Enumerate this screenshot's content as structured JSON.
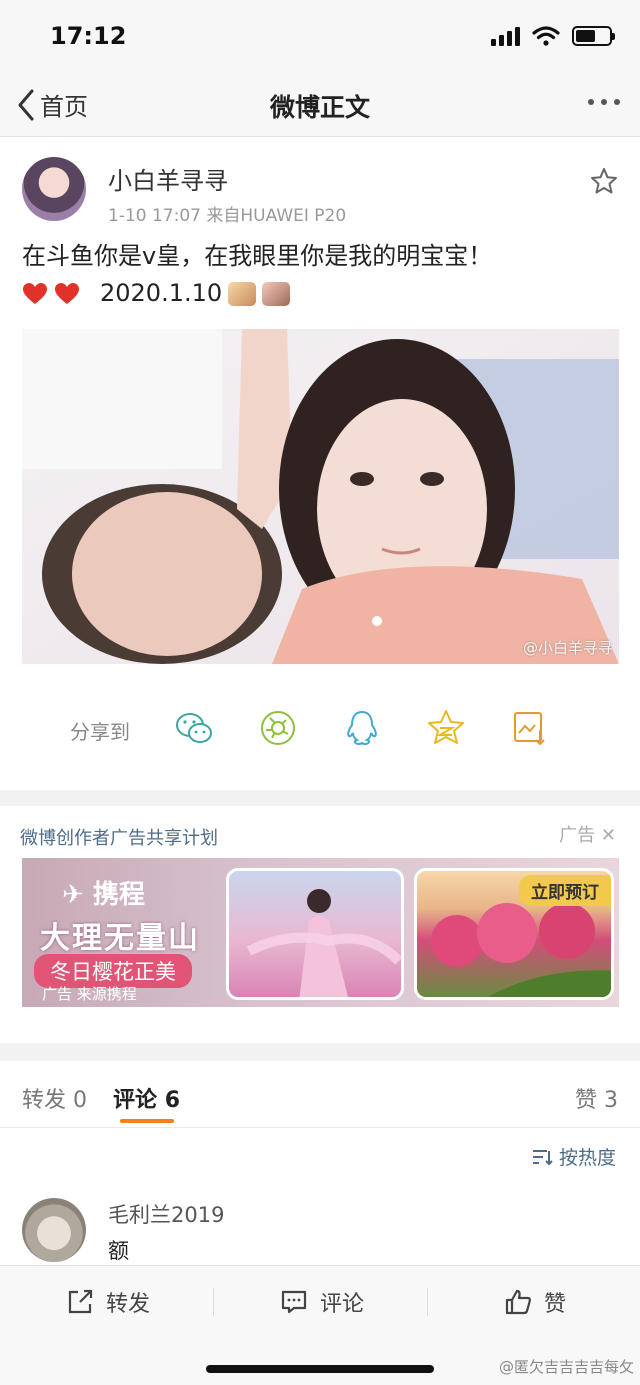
{
  "status_bar": {
    "time": "17:12"
  },
  "nav": {
    "back_label": "首页",
    "title": "微博正文"
  },
  "post": {
    "username": "小白羊寻寻",
    "date": "1-10 17:07",
    "source": "来自HUAWEI P20",
    "text_line1": "在斗鱼你是v皇，在我眼里你是我的明宝宝！",
    "text_line2": "2020.1.10",
    "photo_watermark": "@小白羊寻寻"
  },
  "share": {
    "label": "分享到",
    "targets": [
      "wechat-icon",
      "moments-icon",
      "qq-icon",
      "qzone-icon",
      "save-image-icon"
    ]
  },
  "ad": {
    "title": "微博创作者广告共享计划",
    "close_label": "广告",
    "brand": "携程",
    "headline": "大理无量山",
    "subline": "冬日樱花正美",
    "source": "广告 来源携程",
    "cta": "立即预订"
  },
  "tabs": {
    "repost_label": "转发",
    "repost_count": "0",
    "comment_label": "评论",
    "comment_count": "6",
    "like_label": "赞",
    "like_count": "3"
  },
  "sort_label": "按热度",
  "comments": [
    {
      "name": "毛利兰2019",
      "text": "额"
    }
  ],
  "bottom_bar": {
    "repost": "转发",
    "comment": "评论",
    "like": "赞"
  },
  "watermark": "@匿欠吉吉吉吉每攵",
  "colors": {
    "accent": "#f08121",
    "link": "#4e6c8a"
  }
}
